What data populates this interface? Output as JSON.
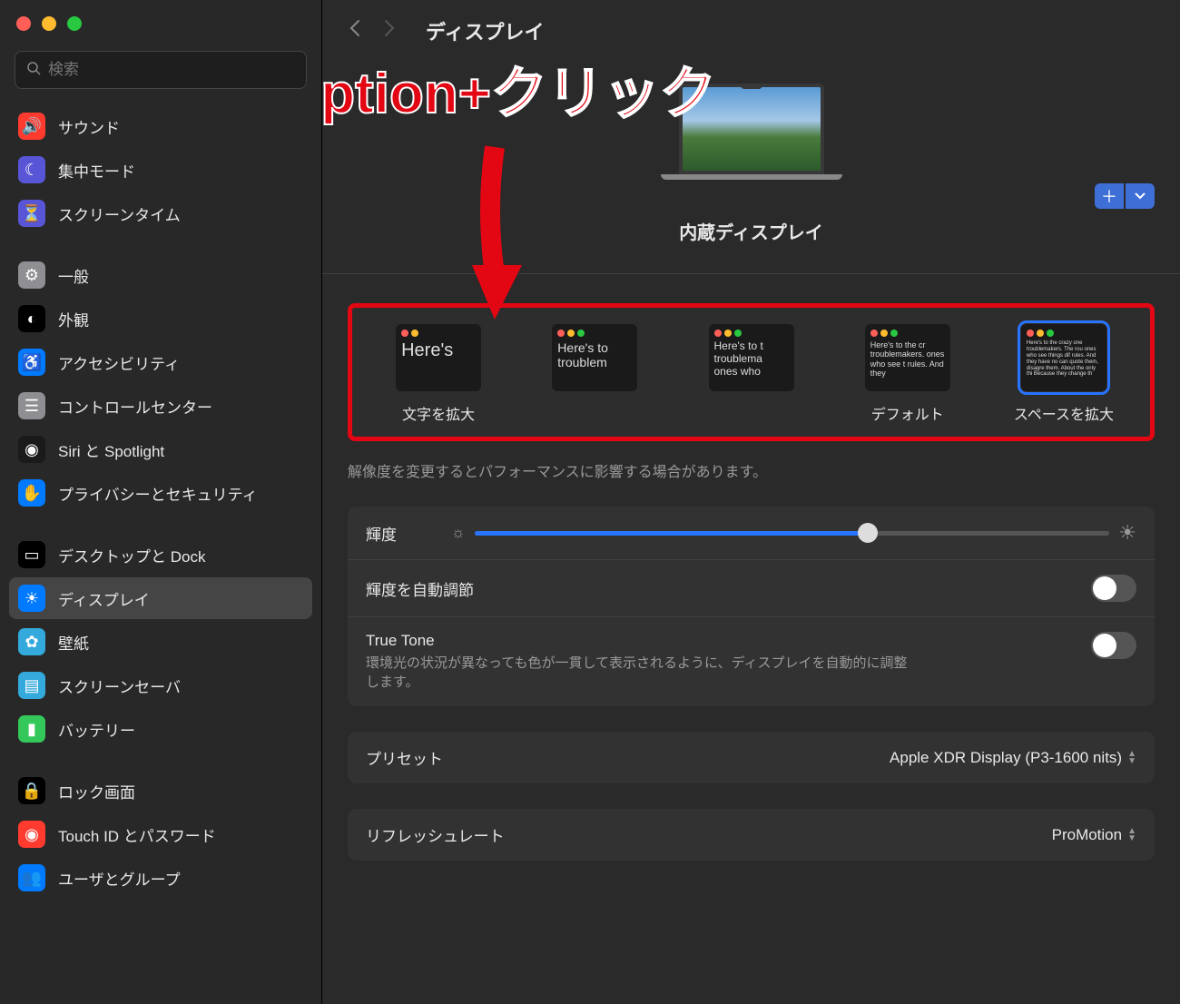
{
  "search": {
    "placeholder": "検索"
  },
  "sidebar": {
    "items": [
      {
        "label": "サウンド",
        "color": "#ff3b30",
        "glyph": "🔊"
      },
      {
        "label": "集中モード",
        "color": "#5856d6",
        "glyph": "☾"
      },
      {
        "label": "スクリーンタイム",
        "color": "#5856d6",
        "glyph": "⏳"
      },
      {
        "label": "一般",
        "color": "#8e8e93",
        "glyph": "⚙"
      },
      {
        "label": "外観",
        "color": "#000",
        "glyph": "◐"
      },
      {
        "label": "アクセシビリティ",
        "color": "#007aff",
        "glyph": "♿"
      },
      {
        "label": "コントロールセンター",
        "color": "#8e8e93",
        "glyph": "☰"
      },
      {
        "label": "Siri と Spotlight",
        "color": "#1a1a1a",
        "glyph": "◉"
      },
      {
        "label": "プライバシーとセキュリティ",
        "color": "#007aff",
        "glyph": "✋"
      },
      {
        "label": "デスクトップと Dock",
        "color": "#000",
        "glyph": "▭"
      },
      {
        "label": "ディスプレイ",
        "color": "#007aff",
        "glyph": "☀"
      },
      {
        "label": "壁紙",
        "color": "#34aadc",
        "glyph": "✿"
      },
      {
        "label": "スクリーンセーバ",
        "color": "#34aadc",
        "glyph": "▤"
      },
      {
        "label": "バッテリー",
        "color": "#34c759",
        "glyph": "▮"
      },
      {
        "label": "ロック画面",
        "color": "#000",
        "glyph": "🔒"
      },
      {
        "label": "Touch ID とパスワード",
        "color": "#ff3b30",
        "glyph": "◉"
      },
      {
        "label": "ユーザとグループ",
        "color": "#007aff",
        "glyph": "👥"
      }
    ],
    "selected": 10,
    "gaps_before": [
      3,
      9,
      14
    ]
  },
  "header": {
    "title": "ディスプレイ"
  },
  "display": {
    "name": "内蔵ディスプレイ"
  },
  "resolution": {
    "options": [
      {
        "label": "文字を拡大",
        "font": 20,
        "text": "Here's",
        "dots": [
          "#ff5f57",
          "#febc2e"
        ]
      },
      {
        "label": "",
        "font": 14,
        "text": "Here's to troublem",
        "dots": [
          "#ff5f57",
          "#febc2e",
          "#28c840"
        ]
      },
      {
        "label": "",
        "font": 12,
        "text": "Here's to t troublema ones who",
        "dots": [
          "#ff5f57",
          "#febc2e",
          "#28c840"
        ]
      },
      {
        "label": "デフォルト",
        "font": 9,
        "text": "Here's to the cr troublemakers. ones who see t rules. And they",
        "dots": [
          "#ff5f57",
          "#febc2e",
          "#28c840"
        ]
      },
      {
        "label": "スペースを拡大",
        "font": 6,
        "text": "Here's to the crazy one troublemakers. The rou ones who see things dif rules. And they have no can quote them, disagre them. About the only thi Because they change th",
        "dots": [
          "#ff5f57",
          "#febc2e",
          "#28c840"
        ]
      }
    ],
    "selected": 4,
    "note": "解像度を変更するとパフォーマンスに影響する場合があります。"
  },
  "settings": {
    "brightness": {
      "label": "輝度",
      "value": 62
    },
    "auto_brightness": {
      "label": "輝度を自動調節",
      "on": false
    },
    "true_tone": {
      "label": "True Tone",
      "desc": "環境光の状況が異なっても色が一貫して表示されるように、ディスプレイを自動的に調整します。",
      "on": false
    },
    "preset": {
      "label": "プリセット",
      "value": "Apple XDR Display (P3-1600 nits)"
    },
    "refresh": {
      "label": "リフレッシュレート",
      "value": "ProMotion"
    }
  },
  "annotation": {
    "text": "Option+クリック"
  }
}
